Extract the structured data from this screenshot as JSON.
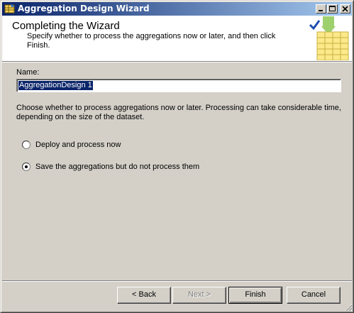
{
  "window": {
    "title": "Aggregation Design Wizard",
    "controls": {
      "minimize": "minimize",
      "maximize": "maximize",
      "close": "close"
    }
  },
  "header": {
    "title": "Completing the Wizard",
    "subtitle": "Specify whether to process the aggregations now or later, and then click Finish.",
    "graphic_icon": "wizard-checkmark-table-icon"
  },
  "form": {
    "name_label": "Name:",
    "name_value": "AggregationDesign 1",
    "description": "Choose whether to process aggregations now or later. Processing can take considerable time, depending on the size of the dataset.",
    "options": [
      {
        "label": "Deploy and process now",
        "selected": false
      },
      {
        "label": "Save the aggregations but do not process them",
        "selected": true
      }
    ]
  },
  "footer": {
    "back_label": "< Back",
    "next_label": "Next >",
    "finish_label": "Finish",
    "cancel_label": "Cancel",
    "next_disabled": true
  },
  "colors": {
    "title_gradient_start": "#0a246a",
    "title_gradient_end": "#a6caf0",
    "face": "#d4d0c8",
    "selection": "#0a246a"
  }
}
